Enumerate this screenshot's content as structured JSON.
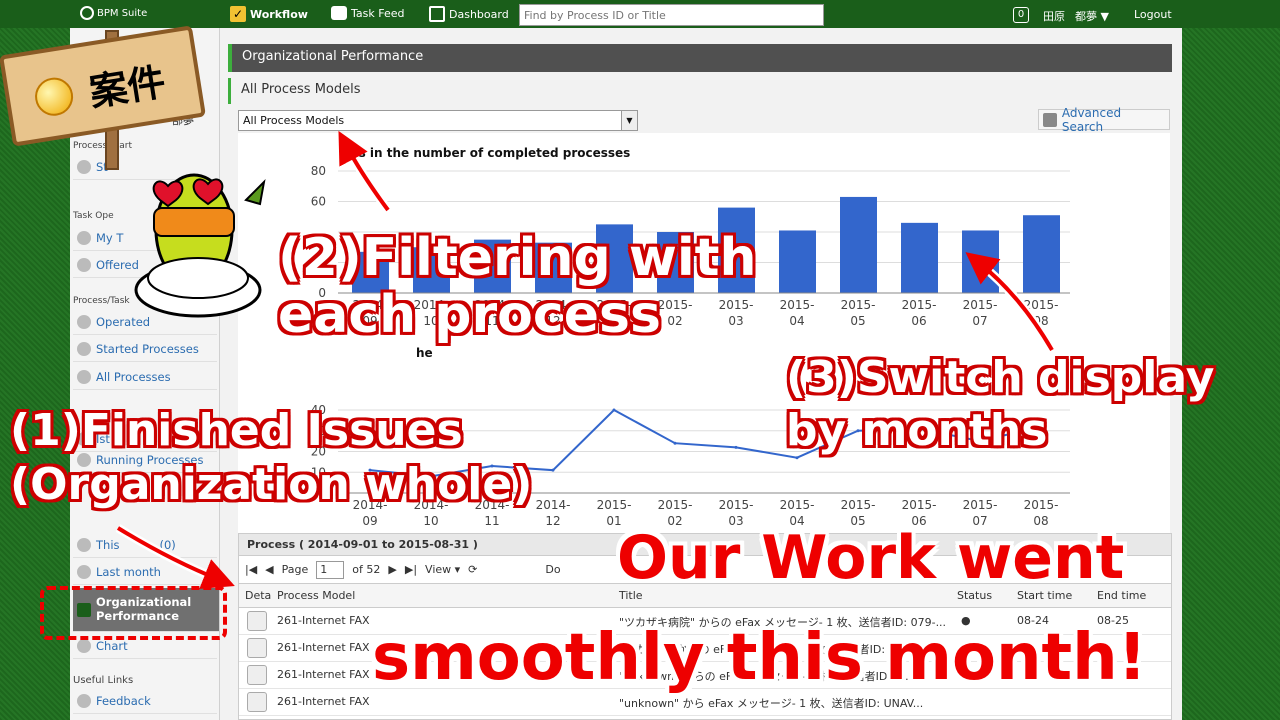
{
  "topbar": {
    "logo": "BPM Suite",
    "nav": [
      {
        "label": "Workflow",
        "icon": "checkbox-icon",
        "active": true
      },
      {
        "label": "Task Feed",
        "icon": "speech-bubble-icon"
      },
      {
        "label": "Dashboard",
        "icon": "dashboard-icon"
      }
    ],
    "search_placeholder": "Find by Process ID or Title",
    "badge_count": "0",
    "user_surname": "田原",
    "user_given": "都夢 ▼",
    "logout": "Logout"
  },
  "sidebar": {
    "fragment": "部夢",
    "sec_process_start": "Process Start",
    "start_item": "St",
    "sec_task": "Task Ope",
    "my_tasks": "My T",
    "offered": "Offered",
    "sec_process_task": "Process/Task",
    "operated": "Operated",
    "started": "Started Processes",
    "all": "All Processes",
    "ist": "Ist",
    "running": "Running Processes",
    "this_month": "This",
    "this_month_count": "(0)",
    "last_month": "Last month",
    "org_perf": "Organizational Performance",
    "chart": "Chart",
    "sec_useful": "Useful Links",
    "feedback": "Feedback"
  },
  "main": {
    "header": "Organizational Performance",
    "subheader": "All Process Models",
    "dropdown_value": "All Process Models",
    "adv_search": "Advanced Search"
  },
  "chart_data": [
    {
      "type": "bar",
      "title": "ds in the number of completed processes",
      "categories": [
        "2014-\n09",
        "2014-\n10",
        "2014-\n11",
        "2014-\n12",
        "2015-\n01",
        "2015-\n02",
        "2015-\n03",
        "2015-\n04",
        "2015-\n05",
        "2015-\n06",
        "2015-\n07",
        "2015-\n08"
      ],
      "values": [
        27,
        30,
        35,
        33,
        45,
        40,
        56,
        41,
        63,
        46,
        41,
        51
      ],
      "ylim": [
        0,
        80
      ],
      "yticks": [
        "80",
        "60",
        "0"
      ],
      "color": "#3366cc"
    },
    {
      "type": "line",
      "title": "he",
      "categories": [
        "2014-\n09",
        "2014-\n10",
        "2014-\n11",
        "2014-\n12",
        "2015-\n01",
        "2015-\n02",
        "2015-\n03",
        "2015-\n04",
        "2015-\n05",
        "2015-\n06",
        "2015-\n07",
        "2015-\n08"
      ],
      "values": [
        11,
        8,
        13,
        11,
        40,
        24,
        22,
        17,
        30,
        31,
        25,
        32
      ],
      "ylim": [
        0,
        40
      ],
      "yticks": [
        "40",
        "30",
        "20",
        "10"
      ],
      "color": "#3366cc"
    }
  ],
  "grid": {
    "title": "Process ( 2014-09-01 to 2015-08-31 )",
    "page_label": "Page",
    "page_value": "1",
    "of_pages": "of 52",
    "view": "View ▾",
    "do_label": "Do",
    "do_label2": "D",
    "headers": [
      "Deta",
      "Process Model",
      "Title",
      "Status",
      "Start time",
      "End time"
    ],
    "rows": [
      {
        "model": "261-Internet FAX",
        "title": "\"ツカザキ病院\" からの eFax メッセージ- 1 枚、送信者ID: 079-...",
        "status": "●",
        "start": "08-24",
        "end": "08-25"
      },
      {
        "model": "261-Internet FAX",
        "title": "\"ツカザキ\" からの eFax メッセージ- 1 枚、送信者ID: UNAV...",
        "status": "",
        "start": "",
        "end": ""
      },
      {
        "model": "261-Internet FAX",
        "title": "\"unknown\" からの eFax メッセージ- 1 枚、送信者ID: 5...",
        "status": "",
        "start": "",
        "end": ""
      },
      {
        "model": "261-Internet FAX",
        "title": "\"unknown\" から eFax メッセージ- 1 枚、送信者ID: UNAV...",
        "status": "",
        "start": "",
        "end": ""
      }
    ]
  },
  "overlay": {
    "sign_text": "案件",
    "note2": "(2)Filtering with\neach process",
    "note3": "(3)Switch display\nby months",
    "note1": "(1)Finished Issues\n(Organization whole)",
    "headline1": "Our Work went",
    "headline2": "smoothly this month!"
  }
}
